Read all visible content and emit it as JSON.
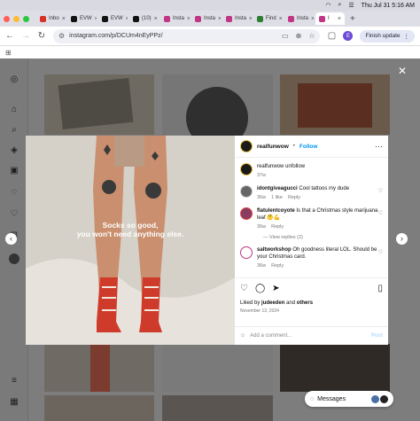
{
  "menubar": {
    "datetime": "Thu Jul 31  5:16 AM"
  },
  "tabs": [
    {
      "label": "Inbo",
      "color": "#d93025"
    },
    {
      "label": "EVW",
      "color": "#111111"
    },
    {
      "label": "EVW",
      "color": "#111111"
    },
    {
      "label": "(10)",
      "color": "#111111"
    },
    {
      "label": "Insta",
      "color": "#c13584"
    },
    {
      "label": "Insta",
      "color": "#c13584"
    },
    {
      "label": "Insta",
      "color": "#c13584"
    },
    {
      "label": "Find",
      "color": "#2e7d32"
    },
    {
      "label": "Insta",
      "color": "#c13584"
    },
    {
      "label": "I",
      "color": "#c13584",
      "active": true
    }
  ],
  "address": {
    "url": "instagram.com/p/DCUm4nEyPPz/",
    "profile_initial": "E",
    "update_label": "Finish update"
  },
  "post": {
    "caption_line1": "Socks so good,",
    "caption_line2": "you won't need anything else.",
    "author": "realfunwow",
    "follow_label": "Follow",
    "header_sep": "•",
    "caption_text": "realfunwow unfollow",
    "caption_age": "37w",
    "comments": [
      {
        "user": "idontgiveagucci",
        "text": "Cool tattoos my dude",
        "age": "36w",
        "likes": "1 like",
        "reply": "Reply"
      },
      {
        "user": "flatulentcoyote",
        "text": "Is that a Christmas style marijuana leaf 🤔💪",
        "age": "36w",
        "reply": "Reply"
      },
      {
        "user": "saltworkshop",
        "text": "Oh goodness literal LOL. Should be your Christmas card.",
        "age": "36w",
        "reply": "Reply"
      }
    ],
    "view_replies": "View replies (2)",
    "liked_by_prefix": "Liked by ",
    "liked_by_user": "judeeden",
    "liked_by_and": " and ",
    "liked_by_others": "others",
    "date": "November 13, 2024",
    "add_comment_placeholder": "Add a comment...",
    "post_label": "Post"
  },
  "messages": {
    "label": "Messages"
  }
}
